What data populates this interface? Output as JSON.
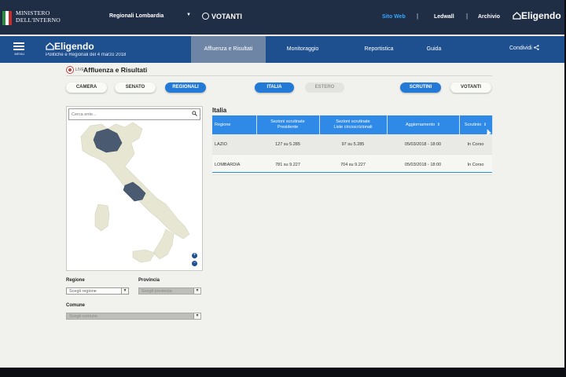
{
  "topbar": {
    "ministry_line1": "MINISTERO",
    "ministry_line2": "DELL'INTERNO",
    "election_select": "Regionali Lombardia",
    "votanti": "VOTANTI",
    "links": {
      "site_web": "Sito Web",
      "ledwall": "Ledwall",
      "archivio": "Archivio"
    },
    "brand": "Eligendo",
    "separator": "|"
  },
  "navbar": {
    "menu_label": "MENU",
    "brand": "Eligendo",
    "subtitle": "Politiche e Regionali del 4 marzo 2018",
    "tabs": [
      {
        "label": "Affluenza e Risultati",
        "active": true
      },
      {
        "label": "Monitoraggio"
      },
      {
        "label": "Reportistica"
      },
      {
        "label": "Guida"
      }
    ],
    "share": "Condividi"
  },
  "header": {
    "live": "LIVE",
    "title": "Affluenza e Risultati"
  },
  "buttons": {
    "camera": "CAMERA",
    "senato": "SENATO",
    "regionali": "REGIONALI",
    "italia": "ITALIA",
    "estero": "ESTERO",
    "scrutini": "SCRUTINI",
    "votanti": "VOTANTI"
  },
  "map": {
    "search_placeholder": "Cerca ente...",
    "colors": {
      "region": "#e6e6d2",
      "highlight": "#4a5a70"
    }
  },
  "filters": {
    "regione_label": "Regione",
    "regione_value": "Scegli regione",
    "provincia_label": "Provincia",
    "provincia_value": "Scegli provincia",
    "comune_label": "Comune",
    "comune_value": "Scegli comune"
  },
  "results": {
    "area": "Italia",
    "columns": [
      {
        "l1": "Regione",
        "l2": ""
      },
      {
        "l1": "Sezioni scrutinate",
        "l2": "Presidente"
      },
      {
        "l1": "Sezioni scrutinate",
        "l2": "Liste circoscrizionali"
      },
      {
        "l1": "Aggiornamento",
        "l2": ""
      },
      {
        "l1": "Scrutinio",
        "l2": ""
      }
    ],
    "rows": [
      [
        "LAZIO",
        "127 su 5.285",
        "97 su 5.285",
        "05/03/2018 - 18:00",
        "In Corso"
      ],
      [
        "LOMBARDIA",
        "781 su 9.227",
        "704 su 9.227",
        "05/03/2018 - 18:00",
        "In Corso"
      ]
    ]
  }
}
